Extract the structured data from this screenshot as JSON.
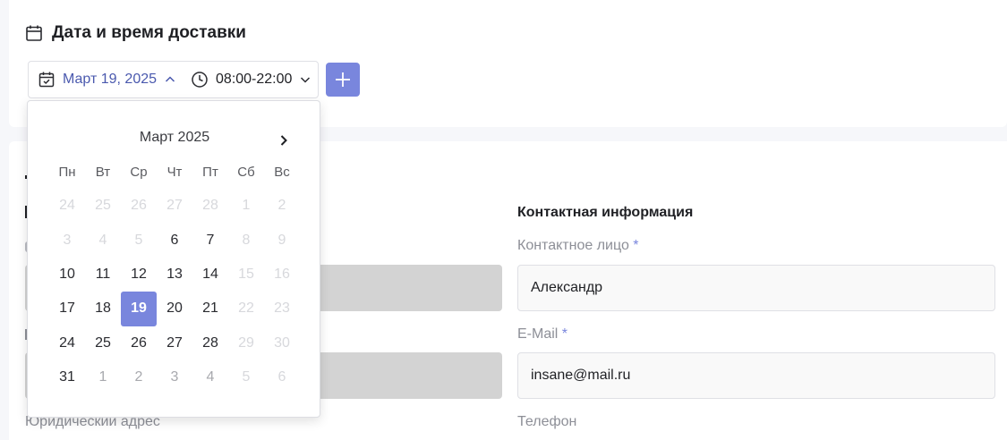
{
  "section": {
    "title": "Дата и время доставки"
  },
  "delivery": {
    "date_value": "Март 19, 2025",
    "time_value": "08:00-22:00"
  },
  "calendar": {
    "month_title": "Март 2025",
    "weekdays": [
      "Пн",
      "Вт",
      "Ср",
      "Чт",
      "Пт",
      "Сб",
      "Вс"
    ],
    "weeks": [
      [
        {
          "d": "24",
          "s": "disabled"
        },
        {
          "d": "25",
          "s": "disabled"
        },
        {
          "d": "26",
          "s": "disabled"
        },
        {
          "d": "27",
          "s": "disabled"
        },
        {
          "d": "28",
          "s": "disabled"
        },
        {
          "d": "1",
          "s": "disabled"
        },
        {
          "d": "2",
          "s": "disabled"
        }
      ],
      [
        {
          "d": "3",
          "s": "disabled"
        },
        {
          "d": "4",
          "s": "disabled"
        },
        {
          "d": "5",
          "s": "disabled"
        },
        {
          "d": "6",
          "s": "normal"
        },
        {
          "d": "7",
          "s": "normal"
        },
        {
          "d": "8",
          "s": "disabled"
        },
        {
          "d": "9",
          "s": "disabled"
        }
      ],
      [
        {
          "d": "10",
          "s": "normal"
        },
        {
          "d": "11",
          "s": "normal"
        },
        {
          "d": "12",
          "s": "normal"
        },
        {
          "d": "13",
          "s": "normal"
        },
        {
          "d": "14",
          "s": "normal"
        },
        {
          "d": "15",
          "s": "disabled"
        },
        {
          "d": "16",
          "s": "disabled"
        }
      ],
      [
        {
          "d": "17",
          "s": "normal"
        },
        {
          "d": "18",
          "s": "normal"
        },
        {
          "d": "19",
          "s": "selected"
        },
        {
          "d": "20",
          "s": "normal"
        },
        {
          "d": "21",
          "s": "normal"
        },
        {
          "d": "22",
          "s": "disabled"
        },
        {
          "d": "23",
          "s": "disabled"
        }
      ],
      [
        {
          "d": "24",
          "s": "normal"
        },
        {
          "d": "25",
          "s": "normal"
        },
        {
          "d": "26",
          "s": "normal"
        },
        {
          "d": "27",
          "s": "normal"
        },
        {
          "d": "28",
          "s": "normal"
        },
        {
          "d": "29",
          "s": "disabled"
        },
        {
          "d": "30",
          "s": "disabled"
        }
      ],
      [
        {
          "d": "31",
          "s": "normal"
        },
        {
          "d": "1",
          "s": "other"
        },
        {
          "d": "2",
          "s": "other"
        },
        {
          "d": "3",
          "s": "other"
        },
        {
          "d": "4",
          "s": "other"
        },
        {
          "d": "5",
          "s": "disabled"
        },
        {
          "d": "6",
          "s": "disabled"
        }
      ]
    ]
  },
  "contact": {
    "heading": "Контактная информация",
    "person_label": "Контактное лицо",
    "person_value": "Александр",
    "email_label": "E-Mail",
    "email_value": "insane@mail.ru",
    "phone_label": "Телефон",
    "required_mark": "*"
  },
  "left": {
    "legal_address_label": "Юридический адрес"
  },
  "colors": {
    "accent": "#7986dd",
    "accent_text": "#4a59ae",
    "field_disabled": "#d3d3d3"
  },
  "icons": {
    "section": "calendar-icon",
    "date": "calendar-check-icon",
    "time": "clock-icon",
    "add": "plus-icon",
    "next": "chevron-right-icon"
  }
}
